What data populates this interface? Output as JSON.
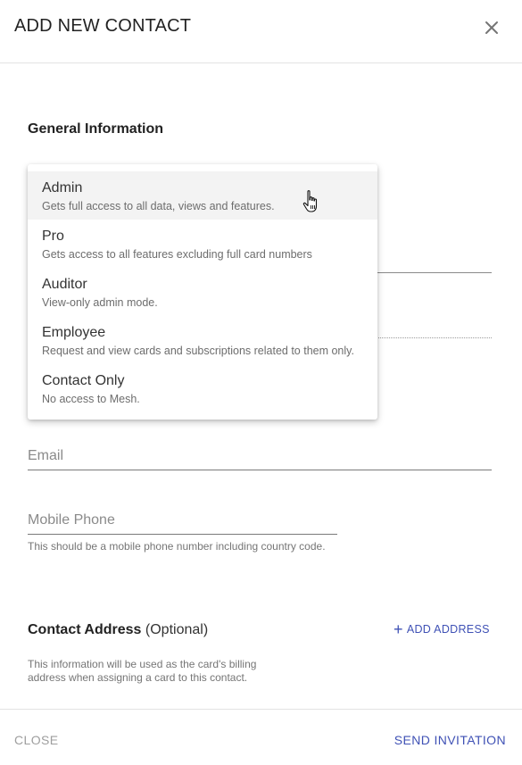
{
  "header": {
    "title": "ADD NEW CONTACT"
  },
  "general": {
    "title": "General Information"
  },
  "role_menu": {
    "items": [
      {
        "name": "Admin",
        "description": "Gets full access to all data, views and features."
      },
      {
        "name": "Pro",
        "description": "Gets access to all features excluding full card numbers"
      },
      {
        "name": "Auditor",
        "description": "View-only admin mode."
      },
      {
        "name": "Employee",
        "description": "Request and view cards and subscriptions related to them only."
      },
      {
        "name": "Contact Only",
        "description": "No access to Mesh."
      }
    ]
  },
  "fields": {
    "email": {
      "label": "Email"
    },
    "mobile": {
      "label": "Mobile Phone",
      "hint": "This should be a mobile phone number including country code."
    }
  },
  "address": {
    "title": "Contact Address",
    "optional": "(Optional)",
    "add_label": "ADD ADDRESS",
    "hint": "This information will be used as the card's billing address when assigning a card to this contact."
  },
  "footer": {
    "close_label": "CLOSE",
    "send_label": "SEND INVITATION"
  },
  "colors": {
    "accent": "#3f51b5",
    "hover_bg": "#f3f3f3"
  }
}
